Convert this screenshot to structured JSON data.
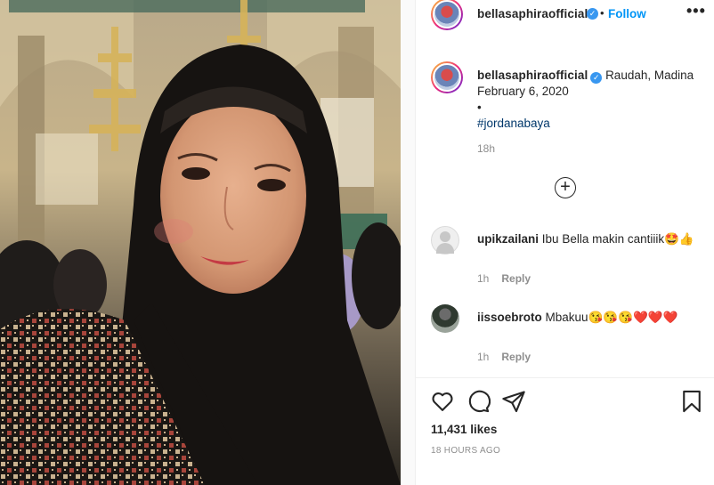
{
  "post": {
    "username": "bellasaphiraofficial",
    "follow_label": "Follow",
    "dot": "•",
    "more": "•••",
    "caption": {
      "username": "bellasaphiraofficial",
      "location": "Raudah, Madina",
      "date": "February 6, 2020",
      "bullet": "•",
      "hashtag": "#jordanabaya",
      "age": "18h"
    },
    "load_more": "+",
    "comments": [
      {
        "username": "upikzailani",
        "text": "Ibu Bella makin cantiiik🤩👍",
        "time": "1h",
        "reply": "Reply"
      },
      {
        "username": "iissoebroto",
        "text": "Mbakuu😘😘😘❤️❤️❤️",
        "time": "1h",
        "reply": "Reply"
      }
    ],
    "likes": "11,431 likes",
    "time_ago": "18 HOURS AGO"
  },
  "icons": {
    "like": "heart-icon",
    "comment": "comment-icon",
    "share": "share-icon",
    "save": "bookmark-icon",
    "verified": "verified-badge-icon"
  },
  "colors": {
    "accent": "#0095f6",
    "verified": "#3897f0",
    "hashtag": "#00376b",
    "muted": "#8e8e8e"
  }
}
